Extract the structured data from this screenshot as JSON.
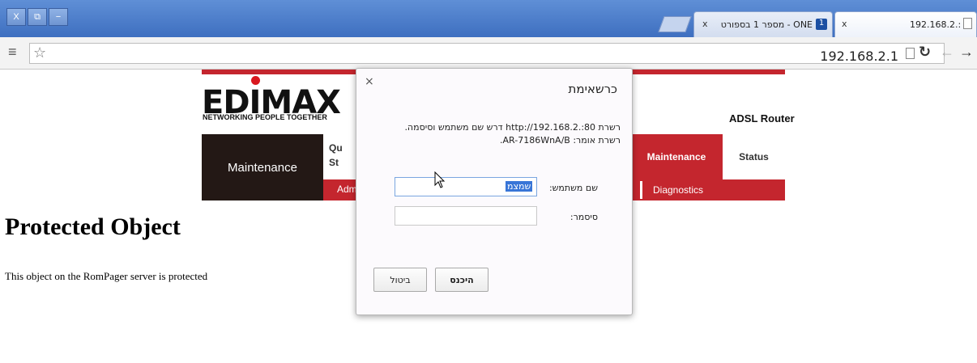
{
  "window": {
    "controls": [
      "X",
      "⧉",
      "−"
    ]
  },
  "tabs": [
    {
      "title": "192.168.2.:",
      "close": "x"
    },
    {
      "title": "ONE - מספר 1 בספורט",
      "close": "x"
    }
  ],
  "toolbar": {
    "url": "192.168.2.1",
    "menu_glyph": "≡",
    "star_glyph": "☆",
    "reload_glyph": "↻",
    "back_glyph": "←",
    "forward_glyph": "→",
    "page_glyph": "🗋"
  },
  "page": {
    "logo": "EDIMAX",
    "tagline": "NETWORKING PEOPLE TOGETHER",
    "product": "ADSL Router",
    "nav_left": "Maintenance",
    "nav_qs_1": "Qu",
    "nav_qs_2": "St",
    "nav_maintenance": "Maintenance",
    "nav_status": "Status",
    "subnav_adm": "Adm",
    "subnav_diag": "Diagnostics",
    "heading": "Protected Object",
    "text": "This object on the RomPager server is protected"
  },
  "dialog": {
    "close": "×",
    "title": "כרשאימת",
    "msg1": "רשרת http://192.168.2.:80 דרש שם משתמש וסיסמה.",
    "msg2": "רשרת אומר: AR-7186WnA/B.",
    "user_label": "שם משתמש:",
    "user_value": "שמצמ",
    "pass_label": "סיסמר:",
    "pass_value": "",
    "login_label": "היכנס",
    "cancel_label": "ביטול"
  },
  "colors": {
    "brand_red": "#c4262e",
    "nav_dark": "#231815",
    "titlebar": "#4a7cc9"
  }
}
